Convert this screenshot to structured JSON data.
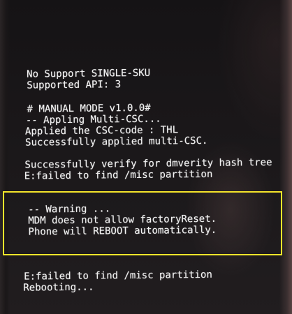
{
  "recovery": {
    "info": {
      "line1": "No Support SINGLE-SKU",
      "line2": "Supported API: 3"
    },
    "csc": {
      "line1": "# MANUAL MODE v1.0.0#",
      "line2": "-- Appling Multi-CSC...",
      "line3": "Applied the CSC-code : THL",
      "line4": "Successfully applied multi-CSC."
    },
    "verity": {
      "line1": "Successfully verify for dmverity hash tree",
      "line2": "E:failed to find /misc partition"
    },
    "warning": {
      "line1": "-- Warning ...",
      "line2": "MDM does not allow factoryReset.",
      "line3": "Phone will REBOOT automatically."
    },
    "footer": {
      "line1": "E:failed to find /misc partition",
      "line2": "Rebooting..."
    }
  },
  "colors": {
    "text": "#f2f2f2",
    "highlight_box": "#f5e52a",
    "screen": "#1a1719"
  }
}
